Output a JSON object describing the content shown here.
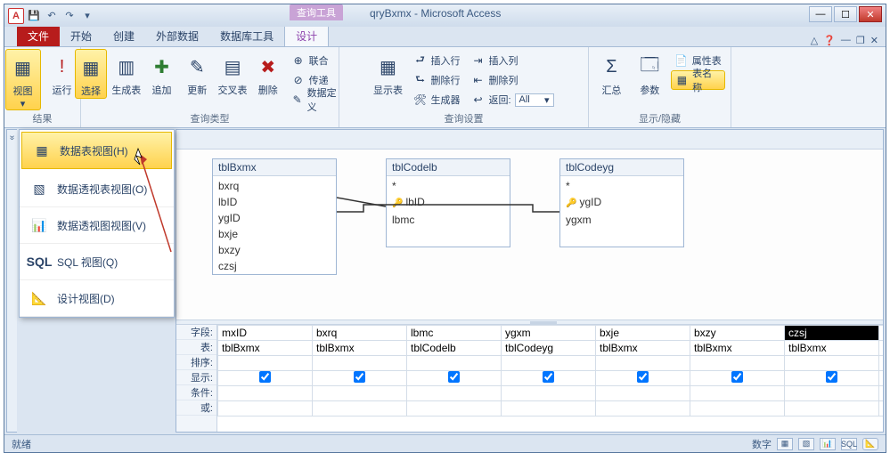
{
  "titlebar": {
    "app_letter": "A",
    "context_tab": "查询工具",
    "doc_title": "qryBxmx - Microsoft Access"
  },
  "tabs": {
    "file": "文件",
    "home": "开始",
    "create": "创建",
    "external": "外部数据",
    "dbtools": "数据库工具",
    "design": "设计"
  },
  "ribbon": {
    "results": {
      "view": "视图",
      "run": "运行",
      "label": "结果"
    },
    "qtype": {
      "select": "选择",
      "maketable": "生成表",
      "append": "追加",
      "update": "更新",
      "crosstab": "交叉表",
      "delete": "删除",
      "union": "联合",
      "passthrough": "传递",
      "datadef": "数据定义",
      "label": "查询类型"
    },
    "setup": {
      "showtable": "显示表",
      "insertrow": "插入行",
      "deleterow": "删除行",
      "builder": "生成器",
      "insertcol": "插入列",
      "deletecol": "删除列",
      "return": "返回:",
      "return_val": "All",
      "label": "查询设置"
    },
    "showhide": {
      "totals": "汇总",
      "params": "参数",
      "propsheet": "属性表",
      "tablenames": "表名称",
      "label": "显示/隐藏"
    }
  },
  "view_menu": {
    "datasheet": "数据表视图(H)",
    "pivottable": "数据透视表视图(O)",
    "pivotchart": "数据透视图视图(V)",
    "sql": "SQL 视图(Q)",
    "design": "设计视图(D)",
    "sql_label": "SQL"
  },
  "tables": {
    "t1": {
      "name": "tblBxmx",
      "fields": [
        "bxrq",
        "lbID",
        "ygID",
        "bxje",
        "bxzy",
        "czsj"
      ]
    },
    "t2": {
      "name": "tblCodelb",
      "fields_star": "*",
      "key": "lbID",
      "f2": "lbmc"
    },
    "t3": {
      "name": "tblCodeyg",
      "fields_star": "*",
      "key": "ygID",
      "f2": "ygxm"
    }
  },
  "grid": {
    "labels": {
      "field": "字段:",
      "table": "表:",
      "sort": "排序:",
      "show": "显示:",
      "criteria": "条件:",
      "or": "或:"
    },
    "cols": [
      {
        "field": "mxID",
        "table": "tblBxmx",
        "show": true
      },
      {
        "field": "bxrq",
        "table": "tblBxmx",
        "show": true
      },
      {
        "field": "lbmc",
        "table": "tblCodelb",
        "show": true
      },
      {
        "field": "ygxm",
        "table": "tblCodeyg",
        "show": true
      },
      {
        "field": "bxje",
        "table": "tblBxmx",
        "show": true
      },
      {
        "field": "bxzy",
        "table": "tblBxmx",
        "show": true
      },
      {
        "field": "czsj",
        "table": "tblBxmx",
        "show": true
      }
    ]
  },
  "statusbar": {
    "ready": "就绪",
    "numlock": "数字",
    "sql": "SQL"
  }
}
